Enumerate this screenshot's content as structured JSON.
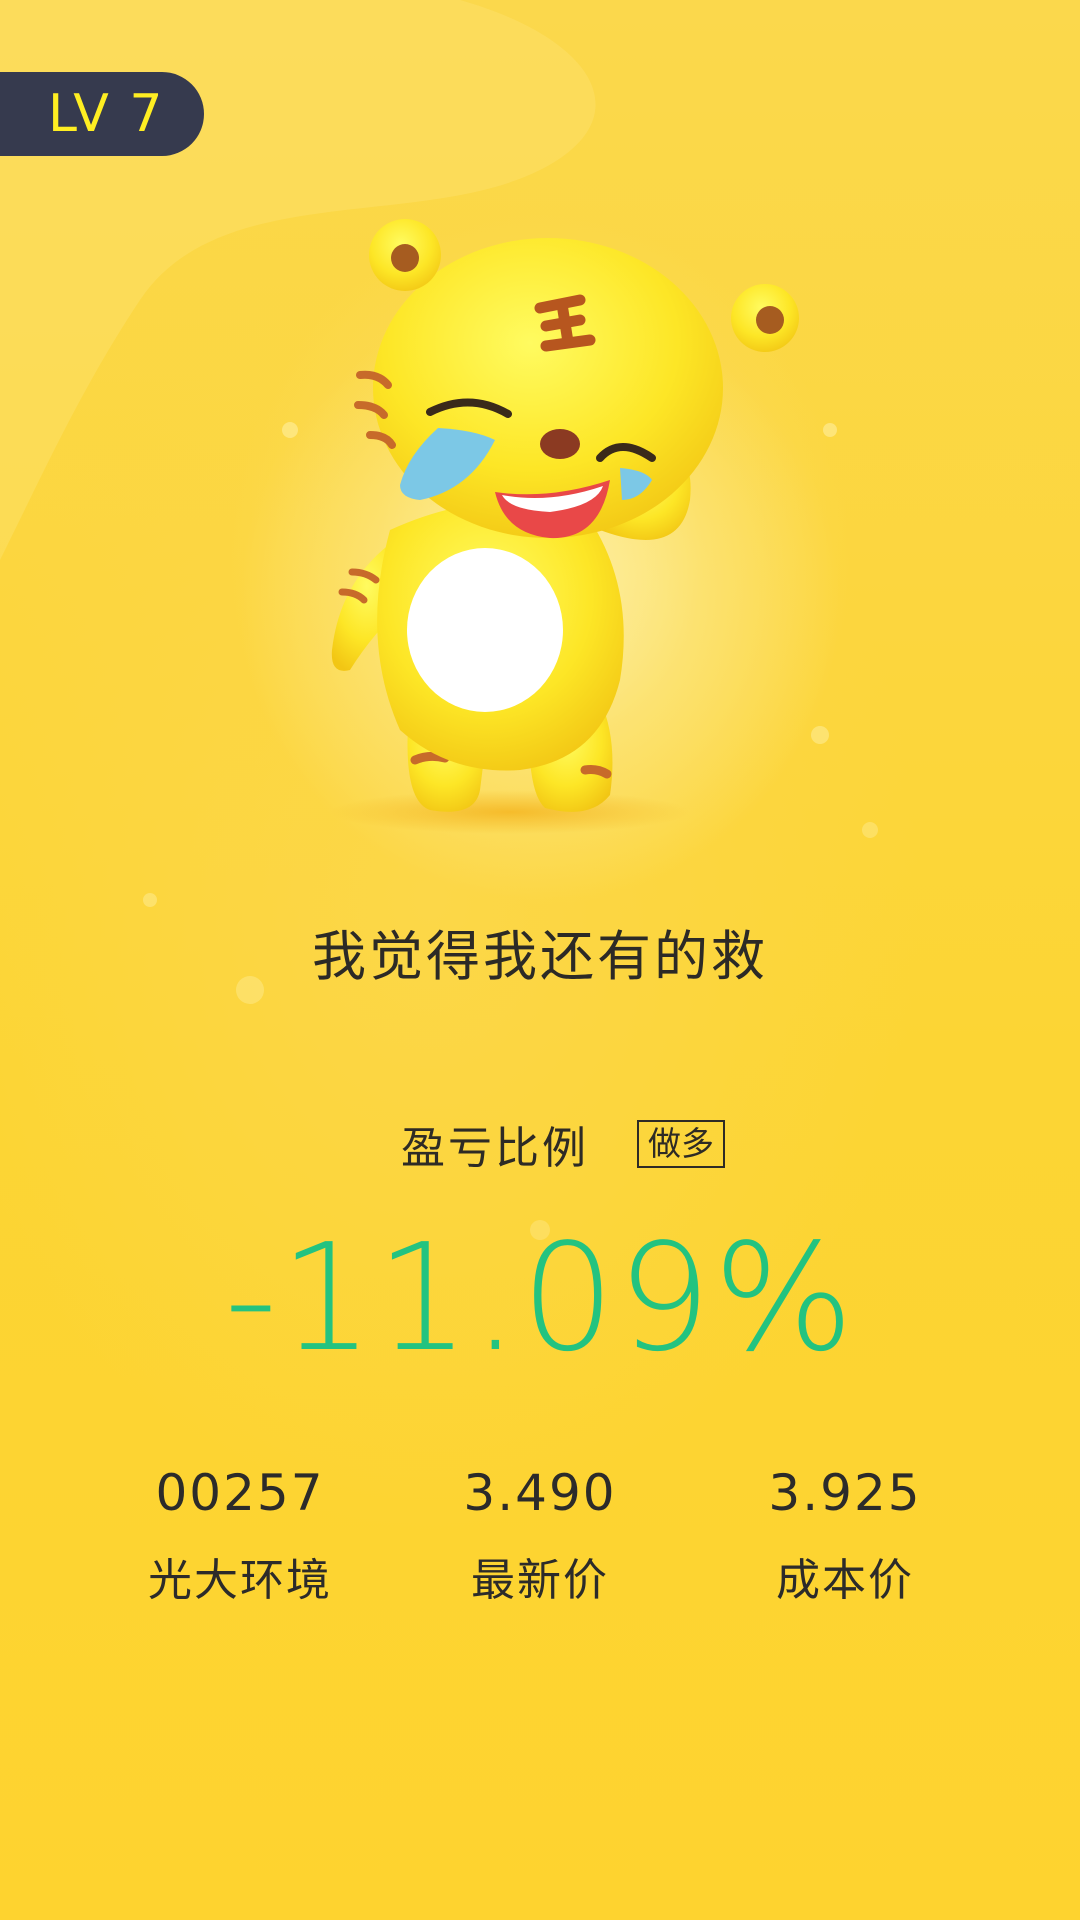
{
  "level": {
    "label": "LV 7"
  },
  "mascot": {
    "icon": "crying-tiger-mascot-icon"
  },
  "slogan": "我觉得我还有的救",
  "profit_loss": {
    "label": "盈亏比例",
    "direction_tag": "做多",
    "value": "-11.09%",
    "value_color": "#23c380"
  },
  "stats": [
    {
      "value": "00257",
      "caption": "光大环境"
    },
    {
      "value": "3.490",
      "caption": "最新价"
    },
    {
      "value": "3.925",
      "caption": "成本价"
    }
  ],
  "colors": {
    "background": "#fcd534",
    "badge": "#363a4e",
    "badge_text": "#ffee22",
    "text": "#2c2a26"
  }
}
